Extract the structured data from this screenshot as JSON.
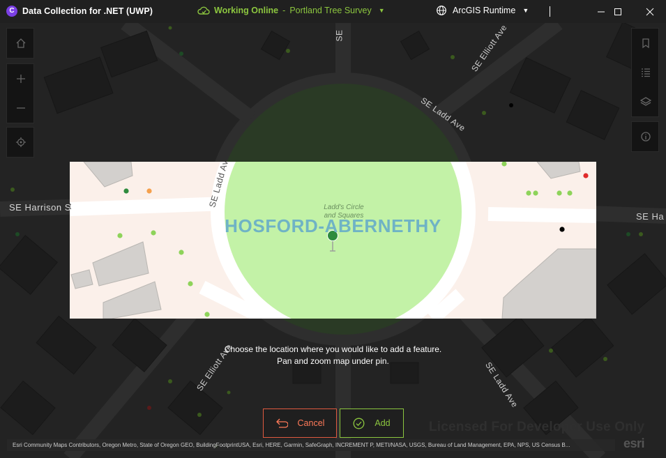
{
  "window": {
    "app_icon_letter": "C",
    "title": "Data Collection for .NET  (UWP)",
    "status_online": "Working Online",
    "status_dash": "-",
    "map_name": "Portland Tree Survey",
    "user_name": "ArcGIS Runtime",
    "controls": [
      "minimize",
      "maximize",
      "close"
    ]
  },
  "toolbar_left": {
    "icons": [
      "home-icon",
      "zoom-in-icon",
      "zoom-out-icon",
      "locate-icon"
    ]
  },
  "toolbar_right": {
    "icons": [
      "bookmark-icon",
      "list-icon",
      "layers-icon",
      "info-icon"
    ]
  },
  "map": {
    "neighborhood_label": "HOSFORD-ABERNETHY",
    "park_label_line1": "Ladd's Circle",
    "park_label_line2": "and Squares",
    "streets": {
      "harrison": "SE Harrison St",
      "ladd": "SE Ladd Ave",
      "elliott": "SE Elliott Ave",
      "se_top": "SE",
      "se_right": "SE Ha"
    }
  },
  "instruction": {
    "line1": "Choose the location where you would like to add a feature.",
    "line2": "Pan and zoom map under pin."
  },
  "buttons": {
    "cancel": "Cancel",
    "add": "Add"
  },
  "watermark": "Licensed For Developer Use Only",
  "attribution": "Esri Community Maps Contributors, Oregon Metro, State of Oregon GEO, BuildingFootprintUSA, Esri, HERE, Garmin, SafeGraph, INCREMENT P, METI/NASA, USGS, Bureau of Land Management, EPA, NPS, US Census B...",
  "esri_logo": "esri",
  "colors": {
    "accent_green": "#8cc63f",
    "cancel_red": "#e05a3f",
    "park_green": "#c3f2a7",
    "title_purple": "#7b3fe4",
    "neighborhood_blue": "#6fb3c5"
  }
}
